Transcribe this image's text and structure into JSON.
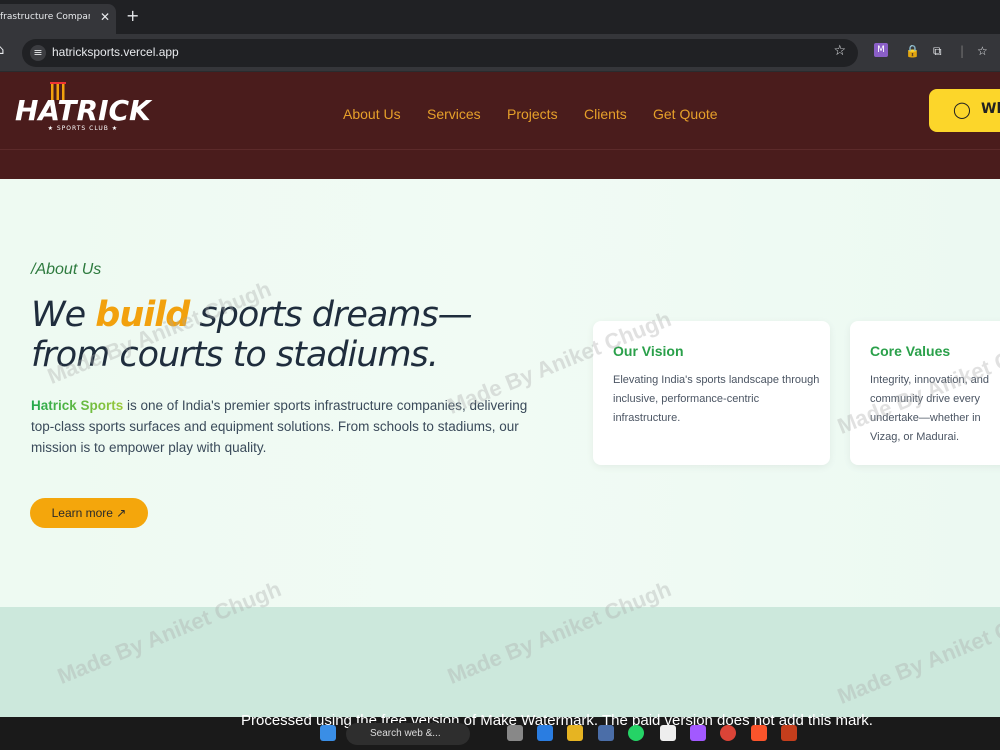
{
  "browser": {
    "tab_title": "frastructure Company in",
    "tab_close": "✕",
    "new_tab": "+",
    "url": "hatricksports.vercel.app",
    "extension_m": "M"
  },
  "header": {
    "logo_word": "HATRICK",
    "logo_sub": "★ SPORTS CLUB ★",
    "nav": [
      "About Us",
      "Services",
      "Projects",
      "Clients",
      "Get Quote"
    ],
    "whatsapp_label": "Wh"
  },
  "hero": {
    "kicker": "/About Us",
    "headline_a": "We ",
    "headline_hl": "build",
    "headline_b": " sports dreams—",
    "headline_c": "from courts to stadiums.",
    "desc_brand": "Hatrick Sports",
    "desc_rest": " is one of India's premier sports infrastructure companies, delivering top-class sports surfaces and equipment solutions. From schools to stadiums, our mission is to empower play with quality.",
    "learn_more": "Learn more ↗"
  },
  "cards": [
    {
      "title": "Our Vision",
      "text": "Elevating India's sports landscape through inclusive, performance-centric infrastructure."
    },
    {
      "title": "Core Values",
      "text": "Integrity, innovation, and community drive every undertake—whether in Vizag, or Madurai."
    }
  ],
  "watermark": "Made By Aniket Chugh",
  "freetext": "Processed using the free version of Make Watermark. The paid version does not add this mark.",
  "taskbar": {
    "search": "Search web &..."
  },
  "colors": {
    "header_bg": "#4a1c1c",
    "accent": "#f4a60c",
    "green": "#2aa04a",
    "nav": "#e6a02a"
  }
}
